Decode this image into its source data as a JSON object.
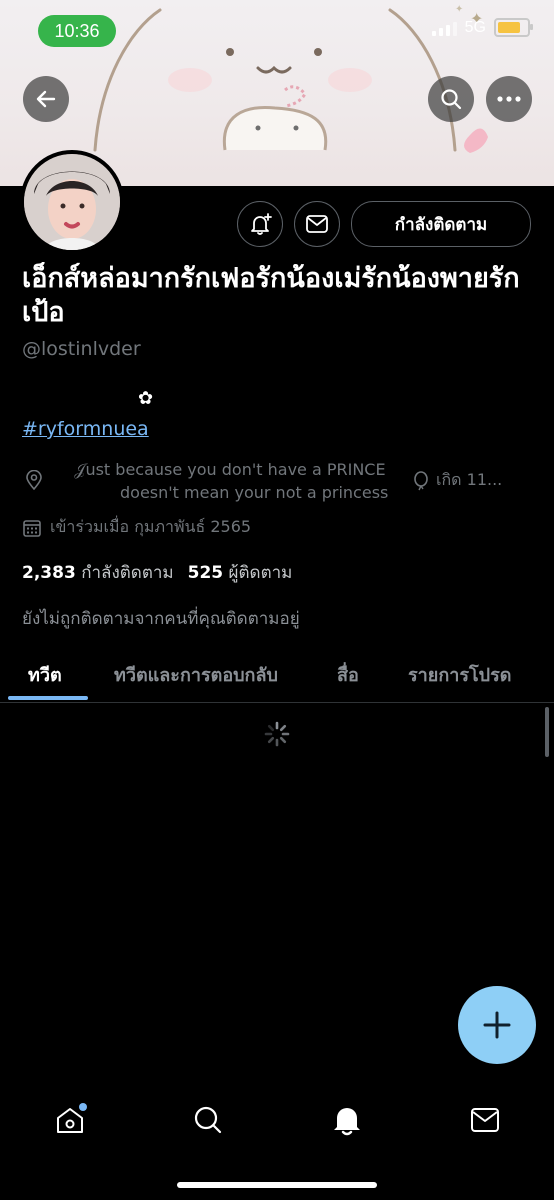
{
  "status_bar": {
    "time": "10:36",
    "network": "5G"
  },
  "profile": {
    "name": "เอ็กส์หล่อมากรักเฟอรักน้องเม่รักน้องพายรักเป้อ",
    "handle": "@lostinlvder",
    "flower": "✿",
    "hashtag": "#ryformnuea",
    "bio_line1": "𝒥ust because you don't have a PRINCE",
    "bio_line2": "doesn't mean your not a princess",
    "birth": "เกิด 11...",
    "joined": "เข้าร่วมเมื่อ กุมภาพันธ์ 2565",
    "following_count": "2,383",
    "following_label": "กำลังติดตาม",
    "followers_count": "525",
    "followers_label": "ผู้ติดตาม",
    "not_followed": "ยังไม่ถูกติดตามจากคนที่คุณติดตามอยู่"
  },
  "actions": {
    "follow_button": "กำลังติดตาม"
  },
  "tabs": [
    {
      "label": "ทวีต",
      "active": true
    },
    {
      "label": "ทวีตและการตอบกลับ",
      "active": false
    },
    {
      "label": "สื่อ",
      "active": false
    },
    {
      "label": "รายการโปรด",
      "active": false
    }
  ],
  "colors": {
    "accent": "#7ab8f5",
    "fab": "#8ecff6",
    "status_pill": "#36b44b"
  },
  "icons": [
    "back-icon",
    "search-icon",
    "more-icon",
    "notification-bell-add-icon",
    "mail-icon",
    "location-icon",
    "balloon-icon",
    "calendar-icon",
    "loading-spinner-icon",
    "plus-icon",
    "home-icon",
    "nav-search-icon",
    "nav-bell-icon",
    "nav-mail-icon"
  ]
}
